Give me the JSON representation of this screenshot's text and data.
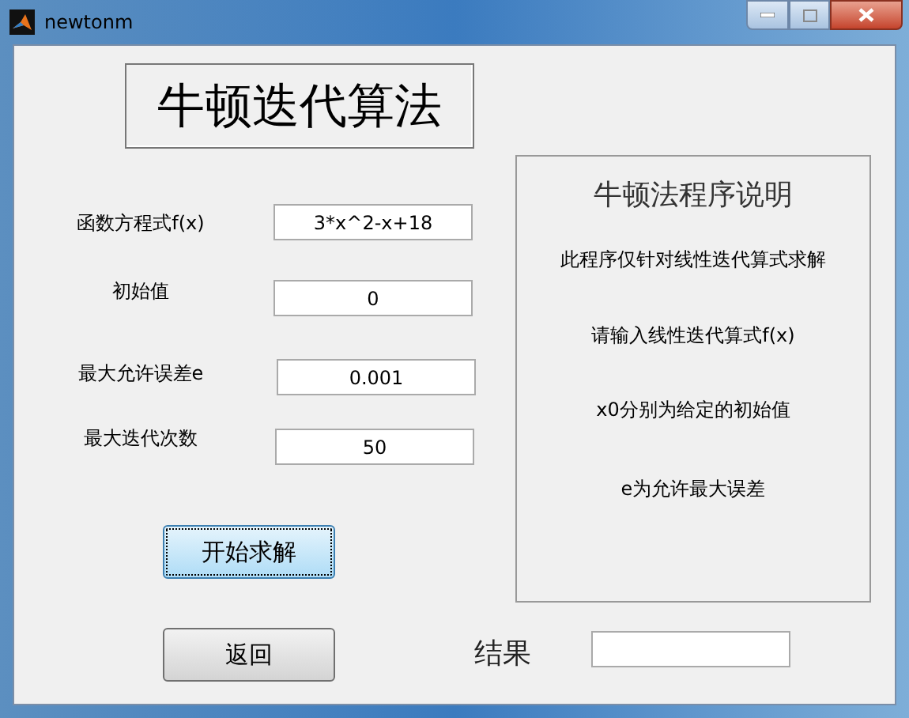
{
  "window": {
    "title": "newtonm"
  },
  "heading": "牛顿迭代算法",
  "params": [
    {
      "label": "函数方程式f(x)",
      "value": "3*x^2-x+18"
    },
    {
      "label": "初始值",
      "value": "0"
    },
    {
      "label": "最大允许误差e",
      "value": "0.001"
    },
    {
      "label": "最大迭代次数",
      "value": "50"
    }
  ],
  "panel": {
    "title": "牛顿法程序说明",
    "lines": [
      "此程序仅针对线性迭代算式求解",
      "请输入线性迭代算式f(x)",
      "x0分别为给定的初始值",
      "e为允许最大误差"
    ]
  },
  "buttons": [
    {
      "label": "开始求解",
      "focused": true
    },
    {
      "label": "返回",
      "focused": false
    }
  ],
  "result": {
    "label": "结果"
  }
}
